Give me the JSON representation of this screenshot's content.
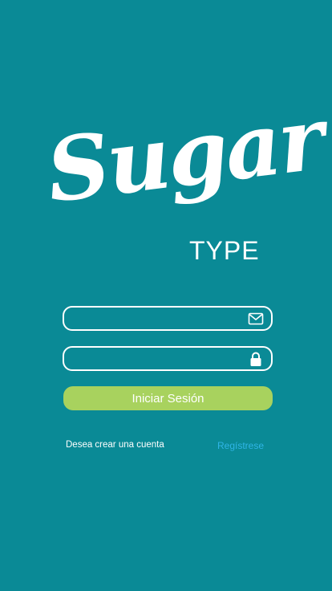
{
  "logo": {
    "script_text": "Sugar",
    "sub_text": "TYPE"
  },
  "form": {
    "email": {
      "value": "",
      "placeholder": "",
      "icon": "mail-icon"
    },
    "password": {
      "value": "",
      "placeholder": "",
      "icon": "lock-icon"
    },
    "login_label": "Iniciar Sesión"
  },
  "footer": {
    "prompt_text": "Desea crear una cuenta",
    "register_label": "Regístrese"
  },
  "colors": {
    "background": "#0a8a96",
    "button": "#a8d25e",
    "link": "#2fb5e6",
    "foreground": "#ffffff"
  }
}
